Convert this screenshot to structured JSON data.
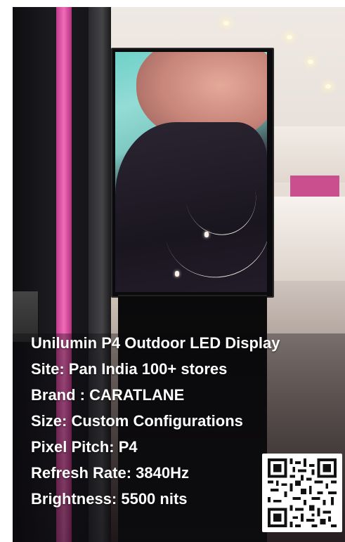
{
  "caption": {
    "lines": [
      "Unilumin P4 Outdoor LED Display",
      "Site: Pan India 100+ stores",
      "Brand : CARATLANE",
      "Size: Custom Configurations",
      "Pixel Pitch: P4",
      "Refresh Rate: 3840Hz",
      "Brightness: 5500 nits"
    ]
  },
  "qr_code": {
    "icon": "qr-code-icon"
  },
  "colors": {
    "text": "#ffffff",
    "pink_accent": "#f06cb7",
    "screen_teal": "#6fd1c9"
  }
}
